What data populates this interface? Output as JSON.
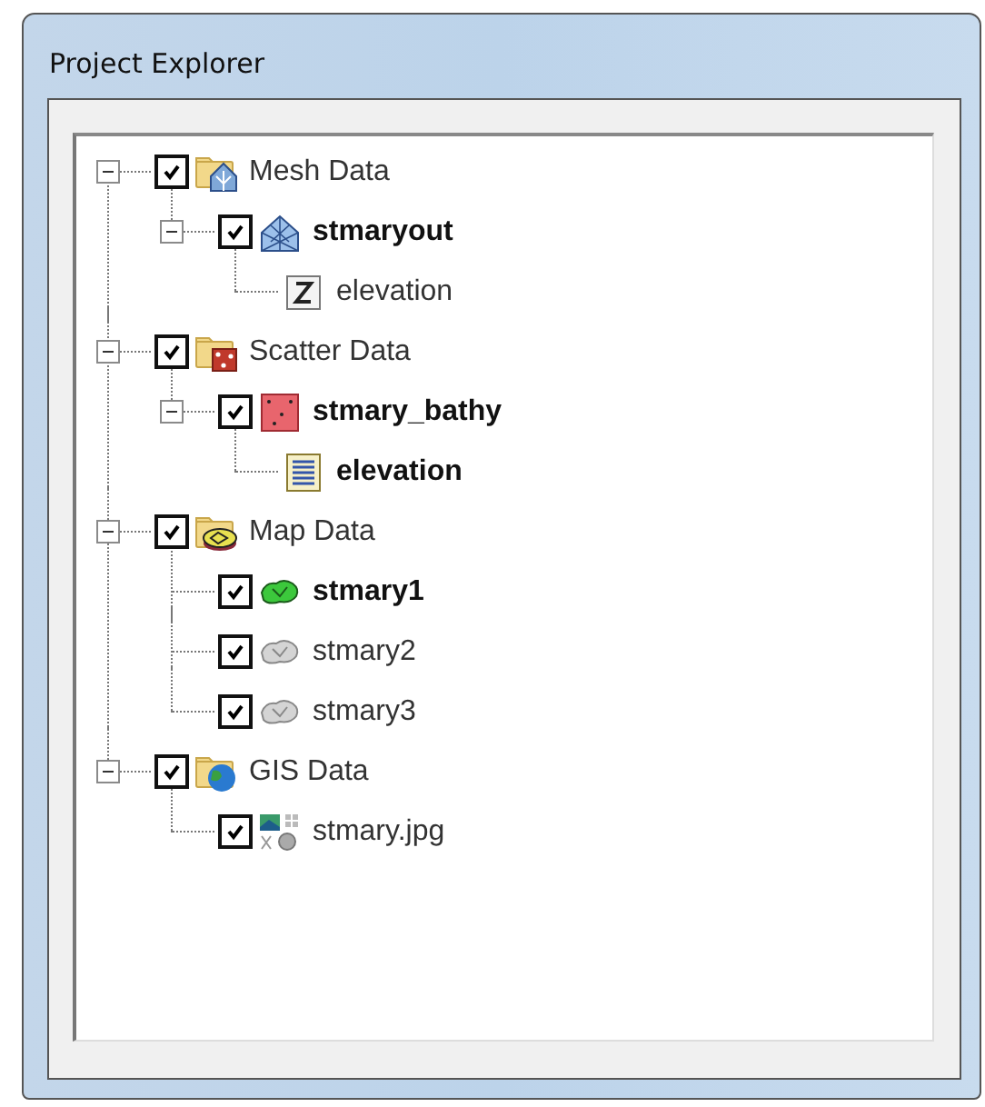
{
  "window": {
    "title": "Project Explorer"
  },
  "tree": [
    {
      "label": "Mesh Data",
      "kind": "mesh-folder",
      "checked": true,
      "expanded": true,
      "bold": false,
      "children": [
        {
          "label": "stmaryout",
          "kind": "mesh",
          "checked": true,
          "expanded": true,
          "bold": true,
          "children": [
            {
              "label": "elevation",
              "kind": "z-dataset",
              "bold": false
            }
          ]
        }
      ]
    },
    {
      "label": "Scatter Data",
      "kind": "scatter-folder",
      "checked": true,
      "expanded": true,
      "bold": false,
      "children": [
        {
          "label": "stmary_bathy",
          "kind": "scatter",
          "checked": true,
          "expanded": true,
          "bold": true,
          "children": [
            {
              "label": "elevation",
              "kind": "table-dataset",
              "bold": true
            }
          ]
        }
      ]
    },
    {
      "label": "Map Data",
      "kind": "map-folder",
      "checked": true,
      "expanded": true,
      "bold": false,
      "children": [
        {
          "label": "stmary1",
          "kind": "coverage-active",
          "checked": true,
          "bold": true
        },
        {
          "label": "stmary2",
          "kind": "coverage",
          "checked": true,
          "bold": false
        },
        {
          "label": "stmary3",
          "kind": "coverage",
          "checked": true,
          "bold": false
        }
      ]
    },
    {
      "label": "GIS Data",
      "kind": "gis-folder",
      "checked": true,
      "expanded": true,
      "bold": false,
      "children": [
        {
          "label": "stmary.jpg",
          "kind": "image",
          "checked": true,
          "bold": false
        }
      ]
    }
  ]
}
